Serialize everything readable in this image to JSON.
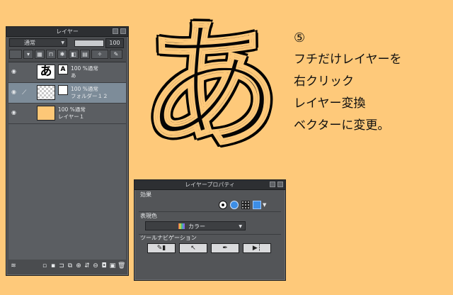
{
  "layer_panel": {
    "title": "レイヤー",
    "blend_mode": "通常",
    "opacity_value": "100",
    "opacity_fraction": 1.0,
    "layers": [
      {
        "thumb_char": "あ",
        "mini_char": "A",
        "line1": "100 %通常",
        "line2": "あ",
        "selected": false
      },
      {
        "thumb_char": "",
        "mini_char": "",
        "line1": "100 %通常",
        "line2": "フォルダー１２",
        "selected": true
      },
      {
        "thumb_char": "",
        "mini_char": "",
        "line1": "100 %通常",
        "line2": "レイヤー１",
        "selected": false
      }
    ]
  },
  "big_character": "あ",
  "instructions": {
    "step": "⑤",
    "lines": [
      "フチだけレイヤーを",
      "右クリック",
      "レイヤー変換",
      "ベクターに変更。"
    ]
  },
  "property_panel": {
    "title": "レイヤープロパティ",
    "effect_label": "効果",
    "expression_label": "表現色",
    "color_value": "カラー",
    "nav_label": "ツールナビゲーション"
  },
  "colors": {
    "background": "#fec97a",
    "panel": "#4a4c4f",
    "selected_layer": "#7d8c99",
    "accent_blue": "#3d8ee6"
  }
}
